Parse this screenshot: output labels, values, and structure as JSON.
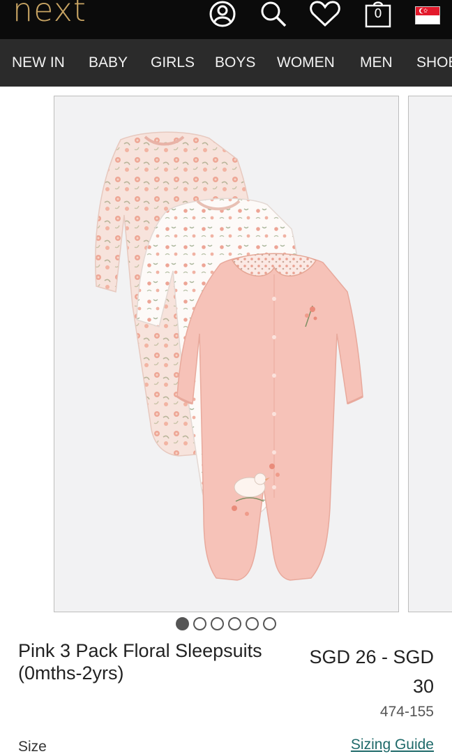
{
  "header": {
    "logo": "next",
    "bag_count": "0",
    "icons": [
      "account-icon",
      "search-icon",
      "wishlist-heart-icon",
      "shopping-bag-icon",
      "singapore-flag-icon"
    ]
  },
  "nav": {
    "items": [
      {
        "label": "NEW IN"
      },
      {
        "label": "BABY"
      },
      {
        "label": "GIRLS"
      },
      {
        "label": "BOYS"
      },
      {
        "label": "WOMEN"
      },
      {
        "label": "MEN"
      },
      {
        "label": "SHOES"
      }
    ]
  },
  "carousel": {
    "image_count": 6,
    "active_index": 0
  },
  "product": {
    "title": "Pink 3 Pack Floral Sleepsuits (0mths-2yrs)",
    "price_line1": "SGD 26 - SGD",
    "price_line2": "30",
    "item_number": "474-155",
    "size_label": "Size",
    "sizing_guide": "Sizing Guide"
  },
  "colors": {
    "header_bg": "#0b0b0b",
    "logo": "#c8a463",
    "nav_bg": "#2b2b2b",
    "sleepsuit_pink": "#f6c2b8",
    "link": "#1f6a6a"
  }
}
